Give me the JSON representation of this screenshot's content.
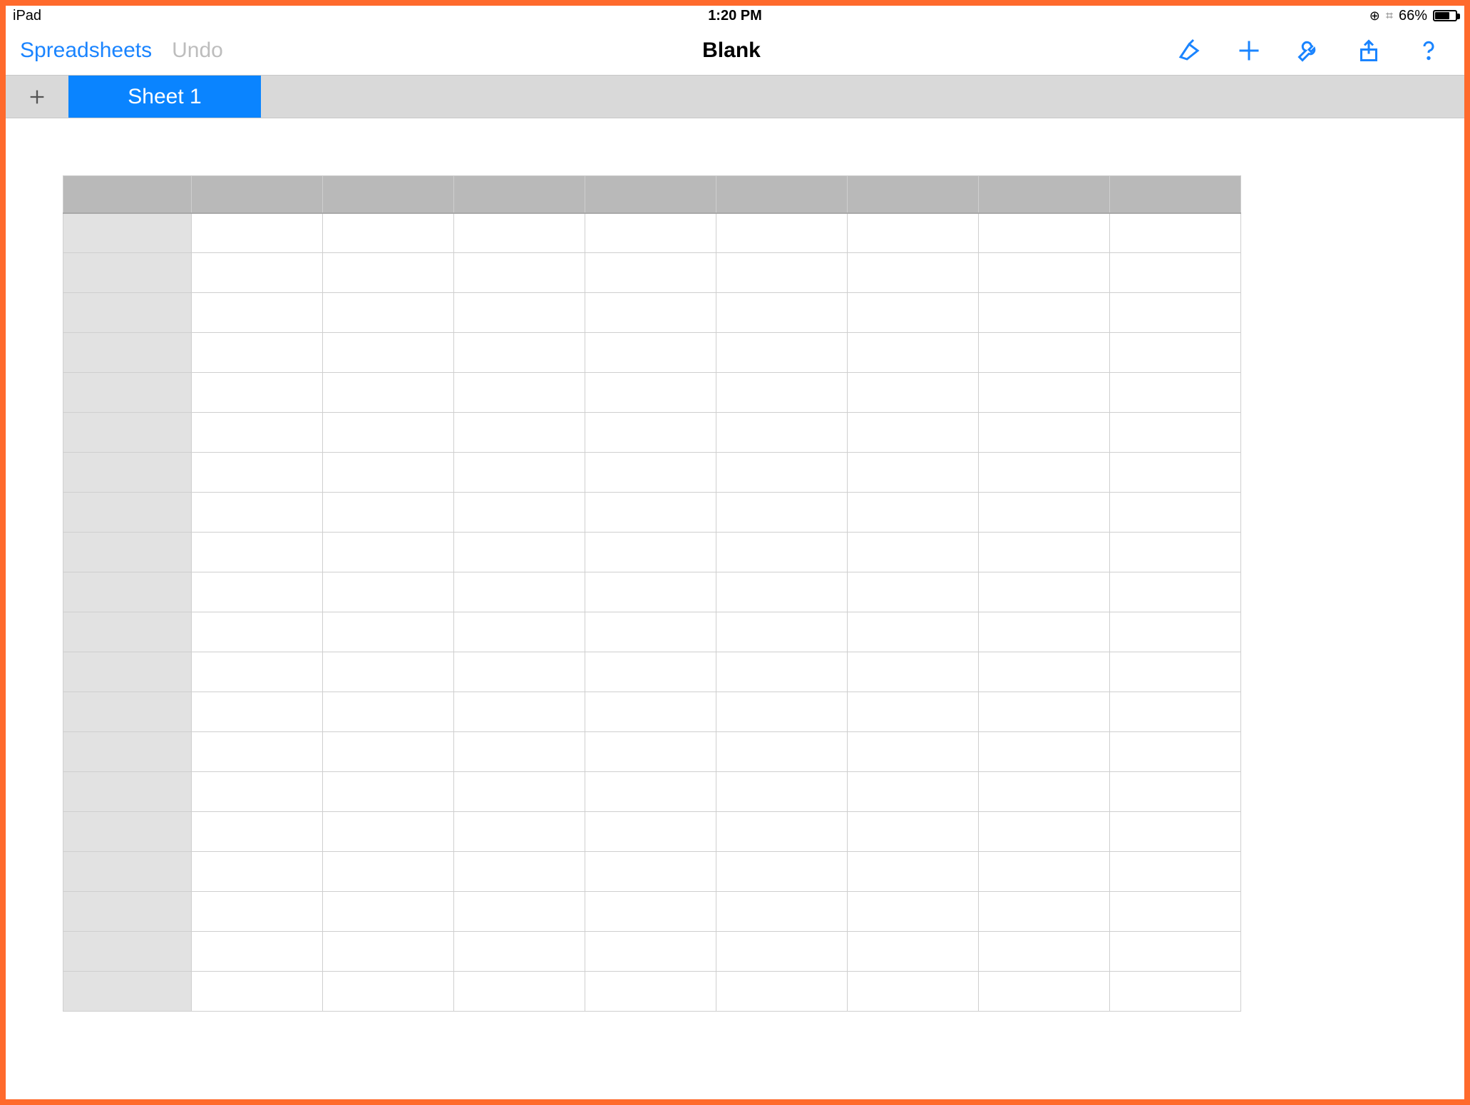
{
  "status": {
    "device": "iPad",
    "time": "1:20 PM",
    "battery_text": "66%",
    "lock_icon": "rotation-lock",
    "bluetooth_icon": "bluetooth"
  },
  "toolbar": {
    "back_label": "Spreadsheets",
    "undo_label": "Undo",
    "title": "Blank",
    "tools": {
      "paint": "format-brush",
      "add": "add",
      "wrench": "tools",
      "share": "share",
      "help": "help"
    }
  },
  "tabs": {
    "active": "Sheet 1"
  },
  "grid": {
    "columns": 8,
    "rows": 20,
    "column_headers": [
      "",
      "",
      "",
      "",
      "",
      "",
      "",
      ""
    ],
    "row_headers": [
      "",
      "",
      "",
      "",
      "",
      "",
      "",
      "",
      "",
      "",
      "",
      "",
      "",
      "",
      "",
      "",
      "",
      "",
      "",
      ""
    ],
    "cells": []
  },
  "colors": {
    "accent": "#0a84ff",
    "frame": "#ff6a2c"
  }
}
